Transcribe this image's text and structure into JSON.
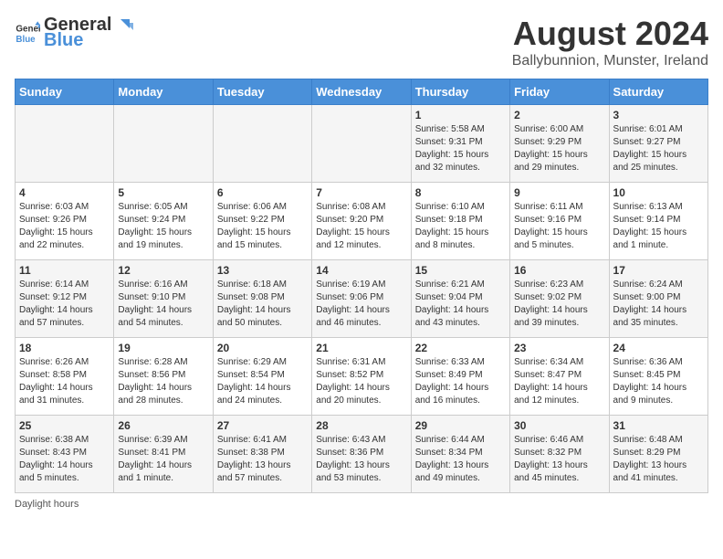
{
  "header": {
    "logo_general": "General",
    "logo_blue": "Blue",
    "title": "August 2024",
    "subtitle": "Ballybunnion, Munster, Ireland"
  },
  "columns": [
    "Sunday",
    "Monday",
    "Tuesday",
    "Wednesday",
    "Thursday",
    "Friday",
    "Saturday"
  ],
  "weeks": [
    [
      {
        "day": "",
        "sunrise": "",
        "sunset": "",
        "daylight": ""
      },
      {
        "day": "",
        "sunrise": "",
        "sunset": "",
        "daylight": ""
      },
      {
        "day": "",
        "sunrise": "",
        "sunset": "",
        "daylight": ""
      },
      {
        "day": "",
        "sunrise": "",
        "sunset": "",
        "daylight": ""
      },
      {
        "day": "1",
        "sunrise": "Sunrise: 5:58 AM",
        "sunset": "Sunset: 9:31 PM",
        "daylight": "Daylight: 15 hours and 32 minutes."
      },
      {
        "day": "2",
        "sunrise": "Sunrise: 6:00 AM",
        "sunset": "Sunset: 9:29 PM",
        "daylight": "Daylight: 15 hours and 29 minutes."
      },
      {
        "day": "3",
        "sunrise": "Sunrise: 6:01 AM",
        "sunset": "Sunset: 9:27 PM",
        "daylight": "Daylight: 15 hours and 25 minutes."
      }
    ],
    [
      {
        "day": "4",
        "sunrise": "Sunrise: 6:03 AM",
        "sunset": "Sunset: 9:26 PM",
        "daylight": "Daylight: 15 hours and 22 minutes."
      },
      {
        "day": "5",
        "sunrise": "Sunrise: 6:05 AM",
        "sunset": "Sunset: 9:24 PM",
        "daylight": "Daylight: 15 hours and 19 minutes."
      },
      {
        "day": "6",
        "sunrise": "Sunrise: 6:06 AM",
        "sunset": "Sunset: 9:22 PM",
        "daylight": "Daylight: 15 hours and 15 minutes."
      },
      {
        "day": "7",
        "sunrise": "Sunrise: 6:08 AM",
        "sunset": "Sunset: 9:20 PM",
        "daylight": "Daylight: 15 hours and 12 minutes."
      },
      {
        "day": "8",
        "sunrise": "Sunrise: 6:10 AM",
        "sunset": "Sunset: 9:18 PM",
        "daylight": "Daylight: 15 hours and 8 minutes."
      },
      {
        "day": "9",
        "sunrise": "Sunrise: 6:11 AM",
        "sunset": "Sunset: 9:16 PM",
        "daylight": "Daylight: 15 hours and 5 minutes."
      },
      {
        "day": "10",
        "sunrise": "Sunrise: 6:13 AM",
        "sunset": "Sunset: 9:14 PM",
        "daylight": "Daylight: 15 hours and 1 minute."
      }
    ],
    [
      {
        "day": "11",
        "sunrise": "Sunrise: 6:14 AM",
        "sunset": "Sunset: 9:12 PM",
        "daylight": "Daylight: 14 hours and 57 minutes."
      },
      {
        "day": "12",
        "sunrise": "Sunrise: 6:16 AM",
        "sunset": "Sunset: 9:10 PM",
        "daylight": "Daylight: 14 hours and 54 minutes."
      },
      {
        "day": "13",
        "sunrise": "Sunrise: 6:18 AM",
        "sunset": "Sunset: 9:08 PM",
        "daylight": "Daylight: 14 hours and 50 minutes."
      },
      {
        "day": "14",
        "sunrise": "Sunrise: 6:19 AM",
        "sunset": "Sunset: 9:06 PM",
        "daylight": "Daylight: 14 hours and 46 minutes."
      },
      {
        "day": "15",
        "sunrise": "Sunrise: 6:21 AM",
        "sunset": "Sunset: 9:04 PM",
        "daylight": "Daylight: 14 hours and 43 minutes."
      },
      {
        "day": "16",
        "sunrise": "Sunrise: 6:23 AM",
        "sunset": "Sunset: 9:02 PM",
        "daylight": "Daylight: 14 hours and 39 minutes."
      },
      {
        "day": "17",
        "sunrise": "Sunrise: 6:24 AM",
        "sunset": "Sunset: 9:00 PM",
        "daylight": "Daylight: 14 hours and 35 minutes."
      }
    ],
    [
      {
        "day": "18",
        "sunrise": "Sunrise: 6:26 AM",
        "sunset": "Sunset: 8:58 PM",
        "daylight": "Daylight: 14 hours and 31 minutes."
      },
      {
        "day": "19",
        "sunrise": "Sunrise: 6:28 AM",
        "sunset": "Sunset: 8:56 PM",
        "daylight": "Daylight: 14 hours and 28 minutes."
      },
      {
        "day": "20",
        "sunrise": "Sunrise: 6:29 AM",
        "sunset": "Sunset: 8:54 PM",
        "daylight": "Daylight: 14 hours and 24 minutes."
      },
      {
        "day": "21",
        "sunrise": "Sunrise: 6:31 AM",
        "sunset": "Sunset: 8:52 PM",
        "daylight": "Daylight: 14 hours and 20 minutes."
      },
      {
        "day": "22",
        "sunrise": "Sunrise: 6:33 AM",
        "sunset": "Sunset: 8:49 PM",
        "daylight": "Daylight: 14 hours and 16 minutes."
      },
      {
        "day": "23",
        "sunrise": "Sunrise: 6:34 AM",
        "sunset": "Sunset: 8:47 PM",
        "daylight": "Daylight: 14 hours and 12 minutes."
      },
      {
        "day": "24",
        "sunrise": "Sunrise: 6:36 AM",
        "sunset": "Sunset: 8:45 PM",
        "daylight": "Daylight: 14 hours and 9 minutes."
      }
    ],
    [
      {
        "day": "25",
        "sunrise": "Sunrise: 6:38 AM",
        "sunset": "Sunset: 8:43 PM",
        "daylight": "Daylight: 14 hours and 5 minutes."
      },
      {
        "day": "26",
        "sunrise": "Sunrise: 6:39 AM",
        "sunset": "Sunset: 8:41 PM",
        "daylight": "Daylight: 14 hours and 1 minute."
      },
      {
        "day": "27",
        "sunrise": "Sunrise: 6:41 AM",
        "sunset": "Sunset: 8:38 PM",
        "daylight": "Daylight: 13 hours and 57 minutes."
      },
      {
        "day": "28",
        "sunrise": "Sunrise: 6:43 AM",
        "sunset": "Sunset: 8:36 PM",
        "daylight": "Daylight: 13 hours and 53 minutes."
      },
      {
        "day": "29",
        "sunrise": "Sunrise: 6:44 AM",
        "sunset": "Sunset: 8:34 PM",
        "daylight": "Daylight: 13 hours and 49 minutes."
      },
      {
        "day": "30",
        "sunrise": "Sunrise: 6:46 AM",
        "sunset": "Sunset: 8:32 PM",
        "daylight": "Daylight: 13 hours and 45 minutes."
      },
      {
        "day": "31",
        "sunrise": "Sunrise: 6:48 AM",
        "sunset": "Sunset: 8:29 PM",
        "daylight": "Daylight: 13 hours and 41 minutes."
      }
    ]
  ],
  "footer": {
    "note": "Daylight hours"
  }
}
